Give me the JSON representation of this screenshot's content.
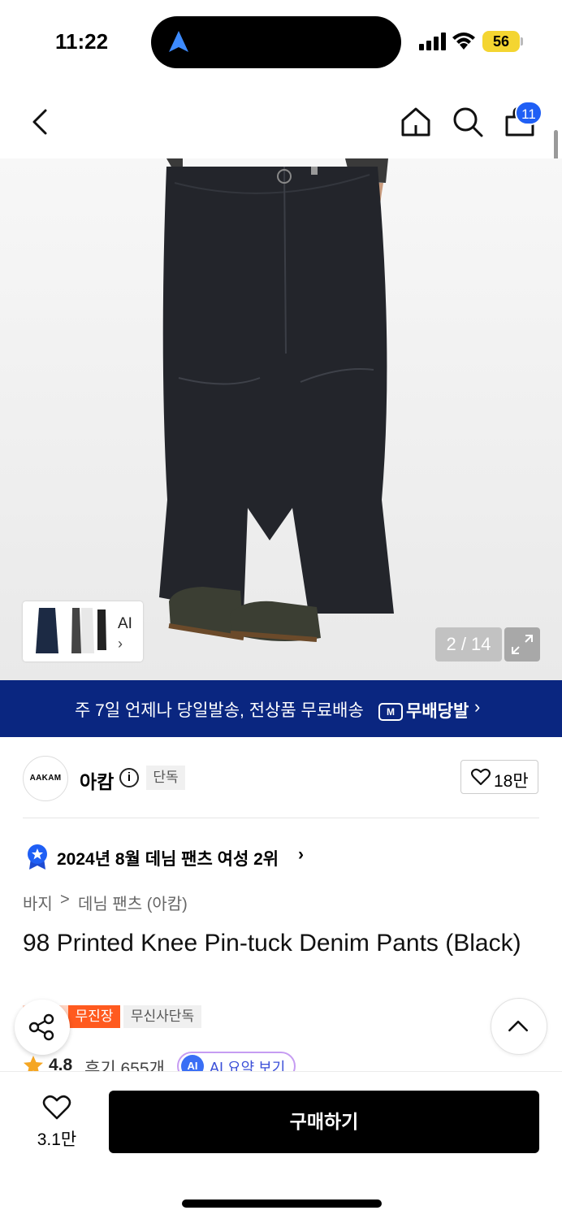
{
  "status_bar": {
    "time": "11:22",
    "battery": "56"
  },
  "header": {
    "cart_count": "11"
  },
  "gallery": {
    "counter": "2 / 14",
    "thumb_label": "AI",
    "thumb_chevron": "›"
  },
  "banner": {
    "text": "주 7일 언제나 당일발송, 전상품 무료배송",
    "logo_text": "무배당발",
    "logo_icon": "M",
    "chevron": "›"
  },
  "brand": {
    "logo_text": "AAKAM",
    "name": "아캄",
    "info_glyph": "i",
    "tag": "단독",
    "likes": "18만"
  },
  "ranking": {
    "text": "2024년 8월 데님 팬츠 여성 2위",
    "chevron": "›"
  },
  "breadcrumb": {
    "category": "바지",
    "separator": ">",
    "subcategory": "데님 팬츠 (아캄)"
  },
  "product": {
    "title": "98 Printed Knee Pin-tuck Denim Pants (Black)"
  },
  "tags": {
    "promo": "무진장",
    "exclusive": "무신사단독"
  },
  "rating": {
    "score": "4.8",
    "reviews": "후기 655개",
    "ai_badge": "AI",
    "ai_summary": "AI 요약 보기"
  },
  "bottom": {
    "like_count": "3.1만",
    "buy_label": "구매하기"
  },
  "colors": {
    "banner": "#0a2680",
    "accent_blue": "#1f5ff5",
    "promo_orange": "#ff5a1f",
    "buy_button": "#000000"
  },
  "icons": [
    "back-icon",
    "home-icon",
    "search-icon",
    "bag-icon",
    "expand-icon",
    "info-icon",
    "heart-icon",
    "ranking-badge-icon",
    "star-icon",
    "share-icon",
    "chevron-up-icon"
  ]
}
